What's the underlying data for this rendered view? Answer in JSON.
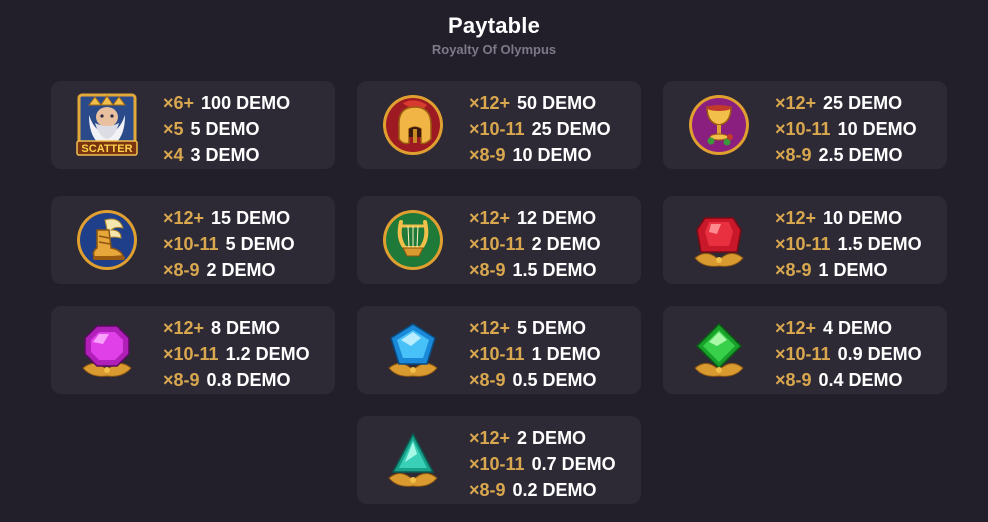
{
  "header": {
    "title": "Paytable",
    "subtitle": "Royalty Of Olympus"
  },
  "symbols": [
    {
      "name": "scatter",
      "icon": "zeus-scatter-icon",
      "label": "SCATTER",
      "pays": [
        {
          "mult": "×6+",
          "value": "100 DEMO"
        },
        {
          "mult": "×5",
          "value": "5 DEMO"
        },
        {
          "mult": "×4",
          "value": "3 DEMO"
        }
      ]
    },
    {
      "name": "helmet",
      "icon": "spartan-helmet-icon",
      "pays": [
        {
          "mult": "×12+",
          "value": "50 DEMO"
        },
        {
          "mult": "×10-11",
          "value": "25 DEMO"
        },
        {
          "mult": "×8-9",
          "value": "10 DEMO"
        }
      ]
    },
    {
      "name": "goblet",
      "icon": "golden-goblet-icon",
      "pays": [
        {
          "mult": "×12+",
          "value": "25 DEMO"
        },
        {
          "mult": "×10-11",
          "value": "10 DEMO"
        },
        {
          "mult": "×8-9",
          "value": "2.5 DEMO"
        }
      ]
    },
    {
      "name": "sandal",
      "icon": "winged-sandal-icon",
      "pays": [
        {
          "mult": "×12+",
          "value": "15 DEMO"
        },
        {
          "mult": "×10-11",
          "value": "5 DEMO"
        },
        {
          "mult": "×8-9",
          "value": "2 DEMO"
        }
      ]
    },
    {
      "name": "lyre",
      "icon": "golden-lyre-icon",
      "pays": [
        {
          "mult": "×12+",
          "value": "12 DEMO"
        },
        {
          "mult": "×10-11",
          "value": "2 DEMO"
        },
        {
          "mult": "×8-9",
          "value": "1.5 DEMO"
        }
      ]
    },
    {
      "name": "red-gem",
      "icon": "red-gem-icon",
      "pays": [
        {
          "mult": "×12+",
          "value": "10 DEMO"
        },
        {
          "mult": "×10-11",
          "value": "1.5 DEMO"
        },
        {
          "mult": "×8-9",
          "value": "1 DEMO"
        }
      ]
    },
    {
      "name": "purple-gem",
      "icon": "purple-gem-icon",
      "pays": [
        {
          "mult": "×12+",
          "value": "8 DEMO"
        },
        {
          "mult": "×10-11",
          "value": "1.2 DEMO"
        },
        {
          "mult": "×8-9",
          "value": "0.8 DEMO"
        }
      ]
    },
    {
      "name": "blue-gem",
      "icon": "blue-gem-icon",
      "pays": [
        {
          "mult": "×12+",
          "value": "5 DEMO"
        },
        {
          "mult": "×10-11",
          "value": "1 DEMO"
        },
        {
          "mult": "×8-9",
          "value": "0.5 DEMO"
        }
      ]
    },
    {
      "name": "green-gem",
      "icon": "green-gem-icon",
      "pays": [
        {
          "mult": "×12+",
          "value": "4 DEMO"
        },
        {
          "mult": "×10-11",
          "value": "0.9 DEMO"
        },
        {
          "mult": "×8-9",
          "value": "0.4 DEMO"
        }
      ]
    },
    {
      "name": "teal-gem",
      "icon": "teal-gem-icon",
      "pays": [
        {
          "mult": "×12+",
          "value": "2 DEMO"
        },
        {
          "mult": "×10-11",
          "value": "0.7 DEMO"
        },
        {
          "mult": "×8-9",
          "value": "0.2 DEMO"
        }
      ]
    }
  ]
}
